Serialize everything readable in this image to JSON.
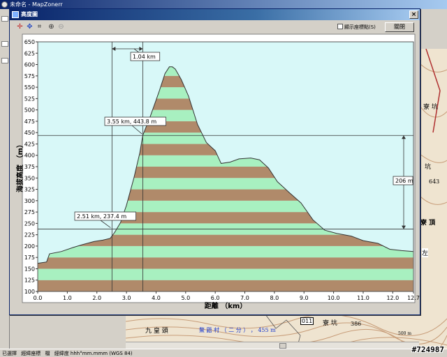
{
  "app": {
    "title": "未命名 - MapZonerr",
    "status": [
      "已選擇",
      "經緯座標",
      "檔",
      "經緯度 hhh°mm.mmm (WGS 84)"
    ]
  },
  "dialog": {
    "title": "高度圖",
    "show_points_label": "顯示座標點(S)",
    "close_label": "關閉",
    "close_icon": "×",
    "tools": [
      "crosshair-icon",
      "move-icon",
      "select-icon",
      "zoom-in-icon",
      "zoom-out-icon"
    ]
  },
  "map": {
    "labels": {
      "jiuhuangtou": "九 皇 頭",
      "liuliaoshan": "鰲 鼯 村 （ 二 分 ） ， 455 m",
      "road_badge": "011",
      "keng1": "寮 坑",
      "elev386": "386",
      "right_keng": "寮 坑",
      "right_keng2": "坑",
      "right_643": "643",
      "right_zuo": "左",
      "right_ding": "寮 頂",
      "scale_label": "500 m",
      "watermark": "#724987"
    }
  },
  "chart_data": {
    "type": "area",
    "xlabel": "距離 （km）",
    "ylabel": "海拔高度 （m）",
    "xlim": [
      0,
      12.7
    ],
    "ylim": [
      100,
      650
    ],
    "x_ticks": [
      0.0,
      1.0,
      2.0,
      3.0,
      4.0,
      5.0,
      6.0,
      7.0,
      8.0,
      9.0,
      10.0,
      11.0,
      12.0,
      12.7
    ],
    "y_ticks": [
      100,
      125,
      150,
      175,
      200,
      225,
      250,
      275,
      300,
      325,
      350,
      375,
      400,
      425,
      450,
      475,
      500,
      525,
      550,
      575,
      600,
      625,
      650
    ],
    "band_height_m": 25,
    "band_colors": [
      "#b08a6a",
      "#a8f0c0"
    ],
    "plot_background": "#d8f8f8",
    "grid": false,
    "profile": [
      [
        0.0,
        162
      ],
      [
        0.3,
        165
      ],
      [
        0.4,
        183
      ],
      [
        0.8,
        188
      ],
      [
        1.2,
        197
      ],
      [
        1.5,
        203
      ],
      [
        1.9,
        210
      ],
      [
        2.2,
        213
      ],
      [
        2.45,
        217
      ],
      [
        2.6,
        230
      ],
      [
        2.8,
        252
      ],
      [
        3.0,
        290
      ],
      [
        3.25,
        350
      ],
      [
        3.45,
        405
      ],
      [
        3.55,
        443.8
      ],
      [
        3.8,
        485
      ],
      [
        4.1,
        540
      ],
      [
        4.3,
        580
      ],
      [
        4.45,
        595
      ],
      [
        4.55,
        595
      ],
      [
        4.65,
        590
      ],
      [
        4.85,
        567
      ],
      [
        5.1,
        530
      ],
      [
        5.4,
        468
      ],
      [
        5.7,
        428
      ],
      [
        6.0,
        410
      ],
      [
        6.2,
        382
      ],
      [
        6.5,
        385
      ],
      [
        6.8,
        392
      ],
      [
        7.2,
        394
      ],
      [
        7.5,
        390
      ],
      [
        7.8,
        372
      ],
      [
        8.1,
        342
      ],
      [
        8.5,
        318
      ],
      [
        8.9,
        295
      ],
      [
        9.3,
        258
      ],
      [
        9.7,
        235
      ],
      [
        10.1,
        228
      ],
      [
        10.6,
        222
      ],
      [
        11.0,
        212
      ],
      [
        11.5,
        206
      ],
      [
        11.9,
        193
      ],
      [
        12.3,
        190
      ],
      [
        12.7,
        188
      ]
    ],
    "annotations": {
      "point_a_label": "2.51 km, 237.4 m",
      "point_a": [
        2.51,
        237.4
      ],
      "point_b_label": "3.55 km, 443.8 m",
      "point_b": [
        3.55,
        443.8
      ],
      "distance_label": "1.04 km",
      "elevation_diff_label": "206 m"
    }
  }
}
